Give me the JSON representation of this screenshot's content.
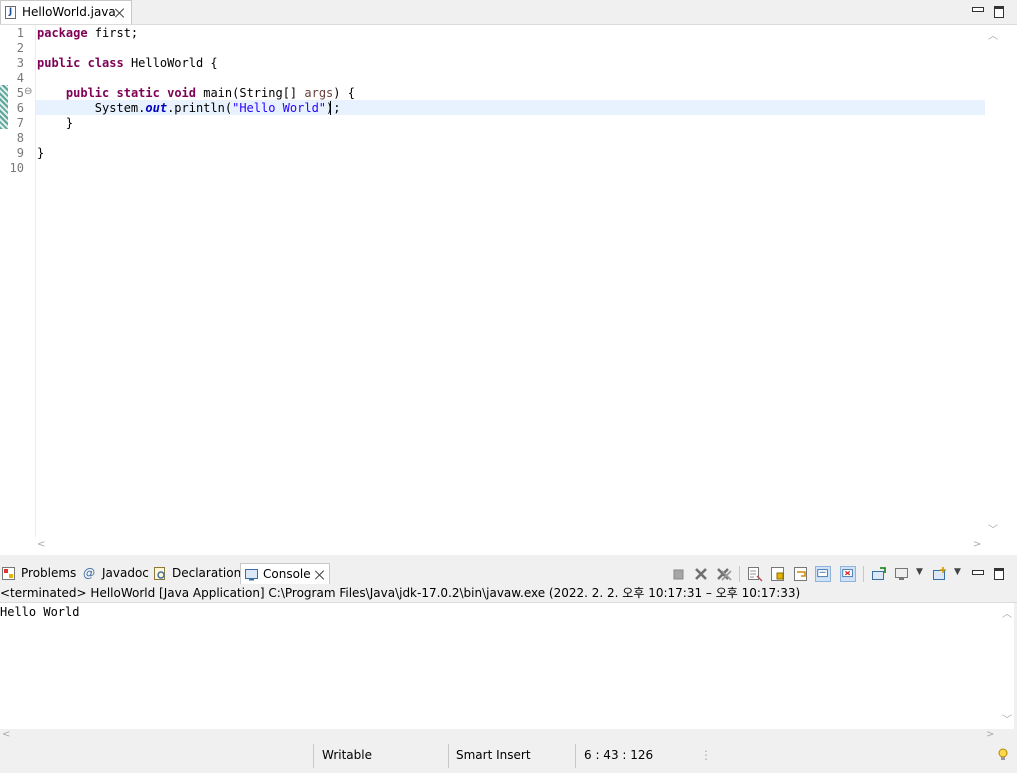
{
  "editor": {
    "tab_label": "HelloWorld.java",
    "file_icon_letter": "J",
    "lines": [
      {
        "n": "1",
        "tokens": [
          {
            "t": "package",
            "c": "kw"
          },
          {
            "t": " first;",
            "c": ""
          }
        ]
      },
      {
        "n": "2",
        "tokens": []
      },
      {
        "n": "3",
        "tokens": [
          {
            "t": "public",
            "c": "kw"
          },
          {
            "t": " ",
            "c": ""
          },
          {
            "t": "class",
            "c": "kw"
          },
          {
            "t": " HelloWorld {",
            "c": ""
          }
        ]
      },
      {
        "n": "4",
        "tokens": []
      },
      {
        "n": "5",
        "tokens": [
          {
            "t": "    ",
            "c": ""
          },
          {
            "t": "public",
            "c": "kw"
          },
          {
            "t": " ",
            "c": ""
          },
          {
            "t": "static",
            "c": "kw"
          },
          {
            "t": " ",
            "c": ""
          },
          {
            "t": "void",
            "c": "kw"
          },
          {
            "t": " main(String[] ",
            "c": ""
          },
          {
            "t": "args",
            "c": "param"
          },
          {
            "t": ") {",
            "c": ""
          }
        ]
      },
      {
        "n": "6",
        "tokens": [
          {
            "t": "        System.",
            "c": ""
          },
          {
            "t": "out",
            "c": "fld"
          },
          {
            "t": ".println(",
            "c": ""
          },
          {
            "t": "\"Hello World\"",
            "c": "str"
          },
          {
            "t": ");",
            "c": ""
          }
        ]
      },
      {
        "n": "7",
        "tokens": [
          {
            "t": "    }",
            "c": ""
          }
        ]
      },
      {
        "n": "8",
        "tokens": []
      },
      {
        "n": "9",
        "tokens": [
          {
            "t": "}",
            "c": ""
          }
        ]
      },
      {
        "n": "10",
        "tokens": []
      }
    ],
    "fold_marker": "⊖"
  },
  "views": {
    "tabs": [
      {
        "label": "Problems",
        "icon": "problems-icon"
      },
      {
        "label": "Javadoc",
        "icon": "javadoc-icon"
      },
      {
        "label": "Declaration",
        "icon": "declaration-icon"
      },
      {
        "label": "Console",
        "icon": "console-icon"
      }
    ]
  },
  "console": {
    "header": "<terminated> HelloWorld [Java Application] C:\\Program Files\\Java\\jdk-17.0.2\\bin\\javaw.exe  (2022. 2. 2. 오후 10:17:31 – 오후 10:17:33)",
    "output": "Hello World"
  },
  "status": {
    "writable": "Writable",
    "insert_mode": "Smart Insert",
    "position": "6 : 43 : 126"
  },
  "colors": {
    "keyword": "#7f0055",
    "string": "#2a00ff",
    "field": "#0000c0",
    "current_line": "#e8f2fe"
  }
}
